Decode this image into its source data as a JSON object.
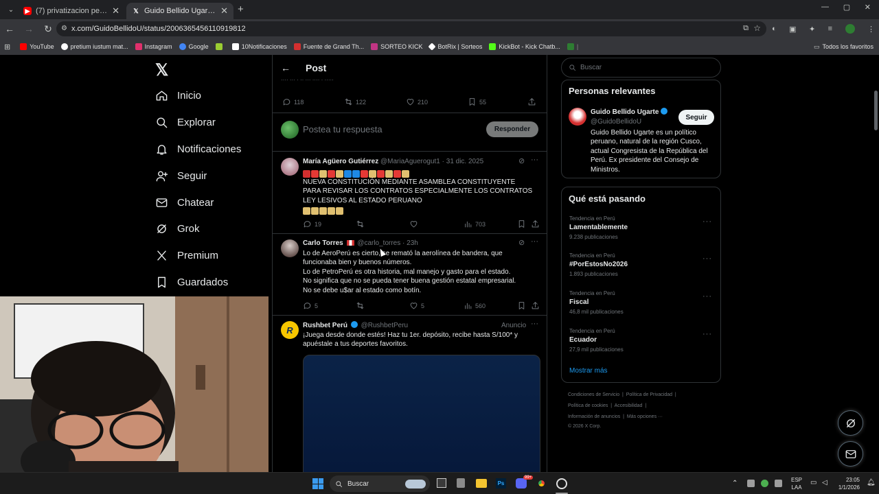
{
  "tabs": [
    {
      "title": "(7) privatizacion petroperu - Yo",
      "favicon": "youtube-icon",
      "color": "#ff0000"
    },
    {
      "title": "Guido Bellido Ugarte en X: \"Co",
      "favicon": "x-icon",
      "color": "#ffffff"
    }
  ],
  "address": {
    "url": "x.com/GuidoBellidoU/status/2006365456110919812"
  },
  "bookmarks": [
    {
      "label": "YouTube",
      "color": "#ff0000"
    },
    {
      "label": "pretium iustum mat...",
      "color": "#ffffff"
    },
    {
      "label": "Instagram",
      "color": "#e1306c"
    },
    {
      "label": "Google",
      "color": "#4285f4"
    },
    {
      "label": "",
      "color": "#9acd32"
    },
    {
      "label": "10Notificaciones",
      "color": "#ffffff"
    },
    {
      "label": "Fuente de Grand Th...",
      "color": "#d32f2f"
    },
    {
      "label": "SORTEO KICK",
      "color": "#c13584"
    },
    {
      "label": "BotRix | Sorteos",
      "color": "#ffffff"
    },
    {
      "label": "KickBot - Kick Chatb...",
      "color": "#53fc18"
    },
    {
      "label": "",
      "color": "#2e7d32"
    }
  ],
  "bookmarks_all": "Todos los favoritos",
  "nav": [
    {
      "label": "Inicio",
      "icon": "home-icon"
    },
    {
      "label": "Explorar",
      "icon": "search-icon"
    },
    {
      "label": "Notificaciones",
      "icon": "bell-icon"
    },
    {
      "label": "Seguir",
      "icon": "person-add-icon"
    },
    {
      "label": "Chatear",
      "icon": "mail-icon"
    },
    {
      "label": "Grok",
      "icon": "grok-icon"
    },
    {
      "label": "Premium",
      "icon": "x-icon"
    },
    {
      "label": "Guardados",
      "icon": "bookmark-icon"
    }
  ],
  "post": {
    "header": "Post",
    "stats": {
      "replies": "118",
      "reposts": "122",
      "likes": "210",
      "bookmarks": "55"
    },
    "reply_placeholder": "Postea tu respuesta",
    "reply_button": "Responder"
  },
  "replies": [
    {
      "name": "María Agüero Gutiérrez",
      "handle": "@MariaAguerogut1 · 31 dic. 2025",
      "text": "NUEVA CONSTITUCIÓN MEDIANTE ASAMBLEA CONSTITUYENTE PARA REVISAR LOS CONTRATOS ESPECIALMENTE LOS CONTRATOS LEY LESIVOS AL ESTADO PERUANO",
      "replies": "19",
      "reposts": "",
      "likes": "",
      "views": "703"
    },
    {
      "name": "Carlo Torres",
      "handle": "@carlo_torres · 23h",
      "lines": [
        "Lo de AeroPerú es cierto, se remató la aerolínea de bandera, que",
        "funcionaba bien y buenos números.",
        "Lo de PetroPerú es otra historia, mal manejo y gasto para el estado.",
        "No significa que no se pueda tener buena gestión estatal empresarial.",
        "No se debe u$ar al estado como botín."
      ],
      "replies": "5",
      "reposts": "",
      "likes": "5",
      "views": "560"
    },
    {
      "name": "Rushbet Perú",
      "handle": "@RushbetPeru",
      "ad": "Anuncio",
      "text": "¡Juega desde donde estés! Haz tu 1er. depósito, recibe hasta S/100* y apuéstale a tus deportes favoritos."
    }
  ],
  "search_placeholder": "Buscar",
  "relevant": {
    "title": "Personas relevantes",
    "name": "Guido Bellido Ugarte",
    "handle": "@GuidoBellidoU",
    "follow": "Seguir",
    "bio": "Guido Bellido Ugarte es un político peruano, natural de la región Cusco, actual Congresista de la República del Perú. Ex presidente del Consejo de Ministros."
  },
  "trending": {
    "title": "Qué está pasando",
    "items": [
      {
        "context": "Tendencia en Perú",
        "topic": "Lamentablemente",
        "posts": "9.238 publicaciones"
      },
      {
        "context": "Tendencia en Perú",
        "topic": "#PorEstosNo2026",
        "posts": "1.893 publicaciones"
      },
      {
        "context": "Tendencia en Perú",
        "topic": "Fiscal",
        "posts": "46,8 mil publicaciones"
      },
      {
        "context": "Tendencia en Perú",
        "topic": "Ecuador",
        "posts": "27,9 mil publicaciones"
      }
    ],
    "more": "Mostrar más"
  },
  "footer": {
    "l1a": "Condiciones de Servicio",
    "l1b": "Política de Privacidad",
    "l2a": "Política de cookies",
    "l2b": "Accesibilidad",
    "l3a": "Información de anuncios",
    "l3b": "Más opciones ···",
    "copy": "© 2026 X Corp."
  },
  "taskbar": {
    "search": "Buscar",
    "lang1": "ESP",
    "lang2": "LAA",
    "time": "23:05",
    "date": "1/1/2026",
    "badge": "99+"
  }
}
